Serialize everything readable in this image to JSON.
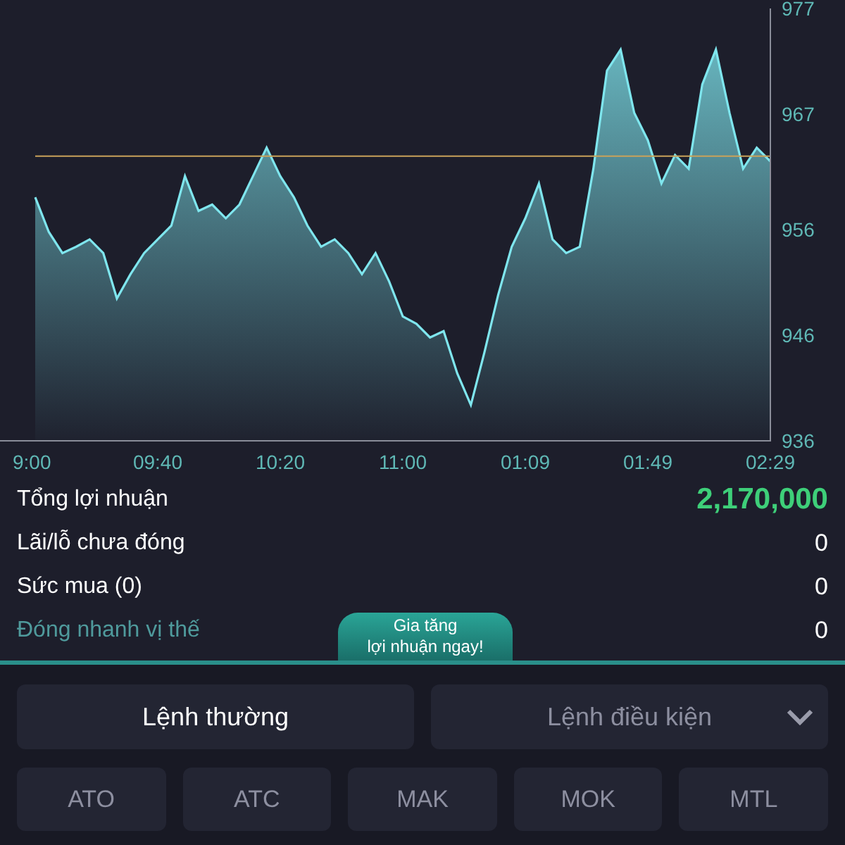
{
  "chart": {
    "chart_data": {
      "type": "area",
      "categories": [
        "9:00",
        null,
        null,
        null,
        null,
        null,
        null,
        null,
        null,
        "09:40",
        null,
        null,
        null,
        null,
        null,
        null,
        null,
        null,
        "10:20",
        null,
        null,
        null,
        null,
        null,
        null,
        null,
        null,
        "11:00",
        null,
        null,
        null,
        null,
        null,
        null,
        null,
        null,
        "01:09",
        null,
        null,
        null,
        null,
        null,
        null,
        null,
        null,
        "01:49",
        null,
        null,
        null,
        null,
        null,
        null,
        null,
        null,
        "02:29"
      ],
      "series": [
        {
          "color": "#7fe6ee",
          "values": [
            959.1,
            955.8,
            953.8,
            954.4,
            955.1,
            953.8,
            949.5,
            951.8,
            953.8,
            955.1,
            956.4,
            961.1,
            957.8,
            958.4,
            957.1,
            958.4,
            961.1,
            963.8,
            961.1,
            959.1,
            956.4,
            954.4,
            955.1,
            953.8,
            951.8,
            953.8,
            951.1,
            947.8,
            947.1,
            945.8,
            946.4,
            942.4,
            939.4,
            944.4,
            949.8,
            954.4,
            957.1,
            960.4,
            955.1,
            953.8,
            954.4,
            961.8,
            971.1,
            973.1,
            967.1,
            964.5,
            960.4,
            963.1,
            961.8,
            969.8,
            973.1,
            967.1,
            961.8,
            963.8,
            962.5
          ]
        },
        {
          "type": "line",
          "color": "#c9a25a",
          "values": [
            963,
            963,
            963,
            963,
            963,
            963,
            963,
            963,
            963,
            963,
            963,
            963,
            963,
            963,
            963,
            963,
            963,
            963,
            963,
            963,
            963,
            963,
            963,
            963,
            963,
            963,
            963,
            963,
            963,
            963,
            963,
            963,
            963,
            963,
            963,
            963,
            963,
            963,
            963,
            963,
            963,
            963,
            963,
            963,
            963,
            963,
            963,
            963,
            963,
            963,
            963,
            963,
            963,
            963,
            963
          ]
        }
      ],
      "ylim": [
        936,
        977
      ],
      "yticks": [
        977,
        967,
        956,
        946,
        936
      ]
    }
  },
  "summary": [
    {
      "label": "Tổng lợi nhuận",
      "value": "2,170,000",
      "kind": "profit"
    },
    {
      "label": "Lãi/lỗ chưa đóng",
      "value": "0",
      "kind": "plain"
    },
    {
      "label": "Sức mua (0)",
      "value": "0",
      "kind": "plain"
    },
    {
      "label": "Đóng nhanh vị thế",
      "value": "0",
      "kind": "link"
    }
  ],
  "promo_tab": {
    "line1": "Gia tăng",
    "line2": "lợi nhuận ngay!"
  },
  "order_types": [
    {
      "label": "Lệnh thường",
      "selected": true,
      "kind": "plain"
    },
    {
      "label": "Lệnh điều kiện",
      "selected": false,
      "kind": "dropdown"
    }
  ],
  "price_types": [
    "ATO",
    "ATC",
    "MAK",
    "MOK",
    "MTL"
  ]
}
